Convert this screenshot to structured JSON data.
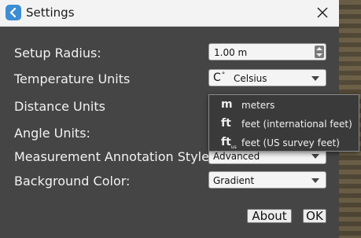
{
  "window": {
    "title": "Settings"
  },
  "rows": [
    {
      "label": "Setup Radius:"
    },
    {
      "label": "Temperature Units"
    },
    {
      "label": "Distance Units"
    },
    {
      "label": "Angle Units:"
    },
    {
      "label": "Measurement Annotation Style:"
    },
    {
      "label": "Background Color:"
    }
  ],
  "controls": {
    "setup_radius": "1.00 m",
    "temperature_glyph": "C",
    "temperature_deg": "°",
    "temperature": "Celsius",
    "annotation_style": "Advanced",
    "background_color": "Gradient"
  },
  "distance_dropdown": {
    "options": [
      {
        "glyph": "m",
        "label": "meters"
      },
      {
        "glyph": "ft",
        "label": "feet (international feet)"
      },
      {
        "glyph": "ft",
        "glyph_sub": "us",
        "label": "feet (US survey feet)"
      }
    ]
  },
  "buttons": {
    "about": "About",
    "ok": "OK"
  },
  "colors": {
    "titlebar": "#f3f3f3",
    "panel": "#454545",
    "accent": "#3d8ed4"
  }
}
